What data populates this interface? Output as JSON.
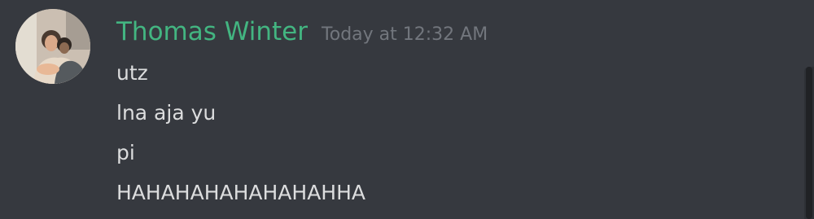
{
  "message_group": {
    "author": "Thomas Winter",
    "timestamp": "Today at 12:32 AM",
    "author_color": "#43b581",
    "avatar_icon": "user-avatar",
    "messages": [
      {
        "text": "utz"
      },
      {
        "text": "lna aja yu"
      },
      {
        "text": "pi"
      },
      {
        "text": "HAHAHAHAHAHAHAHHA"
      }
    ]
  },
  "theme": {
    "background": "#36393f",
    "text": "#dcddde",
    "timestamp": "#72767d"
  }
}
